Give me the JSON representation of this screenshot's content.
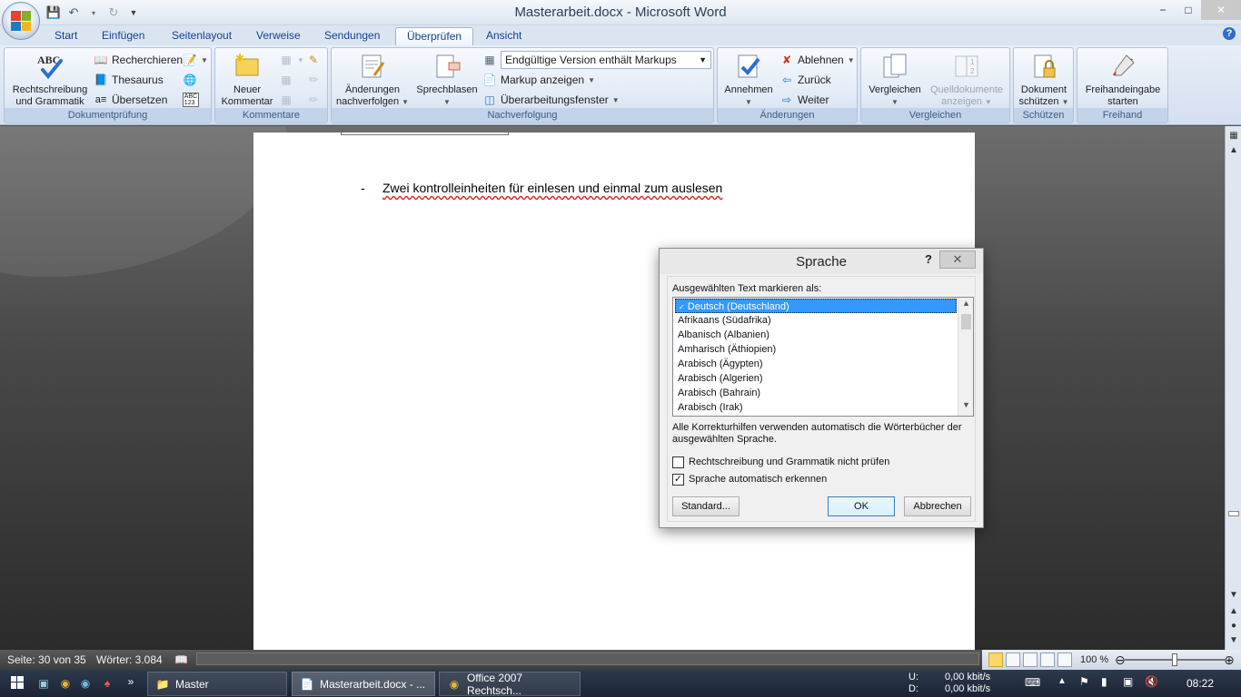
{
  "window": {
    "title": "Masterarbeit.docx - Microsoft Word",
    "minimize": "−",
    "maximize": "□",
    "close": "✕",
    "help": "?"
  },
  "tabs": [
    {
      "label": "Start"
    },
    {
      "label": "Einfügen"
    },
    {
      "label": "Seitenlayout"
    },
    {
      "label": "Verweise"
    },
    {
      "label": "Sendungen"
    },
    {
      "label": "Überprüfen",
      "active": true
    },
    {
      "label": "Ansicht"
    }
  ],
  "ribbon": {
    "proofing": {
      "label": "Dokumentprüfung",
      "spelling_line1": "Rechtschreibung",
      "spelling_line2": "und Grammatik",
      "spelling_icon_text": "ABC",
      "research": "Recherchieren",
      "thesaurus": "Thesaurus",
      "translate": "Übersetzen",
      "wordcount_icon_text": "ABC\n123"
    },
    "comments": {
      "label": "Kommentare",
      "new_line1": "Neuer",
      "new_line2": "Kommentar"
    },
    "tracking": {
      "label": "Nachverfolgung",
      "track_line1": "Änderungen",
      "track_line2": "nachverfolgen",
      "balloons": "Sprechblasen",
      "display_mode": "Endgültige Version enthält Markups",
      "show_markup": "Markup anzeigen",
      "review_pane": "Überarbeitungsfenster"
    },
    "changes": {
      "label": "Änderungen",
      "accept": "Annehmen",
      "reject": "Ablehnen",
      "previous": "Zurück",
      "next": "Weiter"
    },
    "compare": {
      "label": "Vergleichen",
      "compare": "Vergleichen",
      "source_line1": "Quelldokumente",
      "source_line2": "anzeigen"
    },
    "protect": {
      "label": "Schützen",
      "line1": "Dokument",
      "line2": "schützen"
    },
    "ink": {
      "label": "Freihand",
      "line1": "Freihandeingabe",
      "line2": "starten"
    }
  },
  "document": {
    "bullet": "-",
    "line": "Zwei kontrolleinheiten für einlesen und einmal zum auslesen"
  },
  "dialog": {
    "title": "Sprache",
    "help": "?",
    "close": "✕",
    "list_label": "Ausgewählten Text markieren als:",
    "languages": [
      "Deutsch (Deutschland)",
      "Afrikaans (Südafrika)",
      "Albanisch (Albanien)",
      "Amharisch (Äthiopien)",
      "Arabisch (Ägypten)",
      "Arabisch (Algerien)",
      "Arabisch (Bahrain)",
      "Arabisch (Irak)"
    ],
    "selected_index": 0,
    "info": "Alle Korrekturhilfen verwenden automatisch die Wörterbücher der ausgewählten Sprache.",
    "no_proof_label": "Rechtschreibung und Grammatik nicht prüfen",
    "no_proof_checked": false,
    "auto_detect_label": "Sprache automatisch erkennen",
    "auto_detect_checked": true,
    "default_btn": "Standard...",
    "ok_btn": "OK",
    "cancel_btn": "Abbrechen"
  },
  "status": {
    "page": "Seite: 30 von 35",
    "words": "Wörter: 3.084",
    "zoom": "100 %"
  },
  "taskbar": {
    "items": [
      "Master",
      "Masterarbeit.docx - ...",
      "Office 2007 Rechtsch..."
    ],
    "net_up_label": "U:",
    "net_up": "0,00 kbit/s",
    "net_down_label": "D:",
    "net_down": "0,00 kbit/s",
    "time": "08:22"
  },
  "colors": {
    "selection": "#3399ff",
    "ribbon_text": "#15428b",
    "misspelling": "#dd2222"
  }
}
